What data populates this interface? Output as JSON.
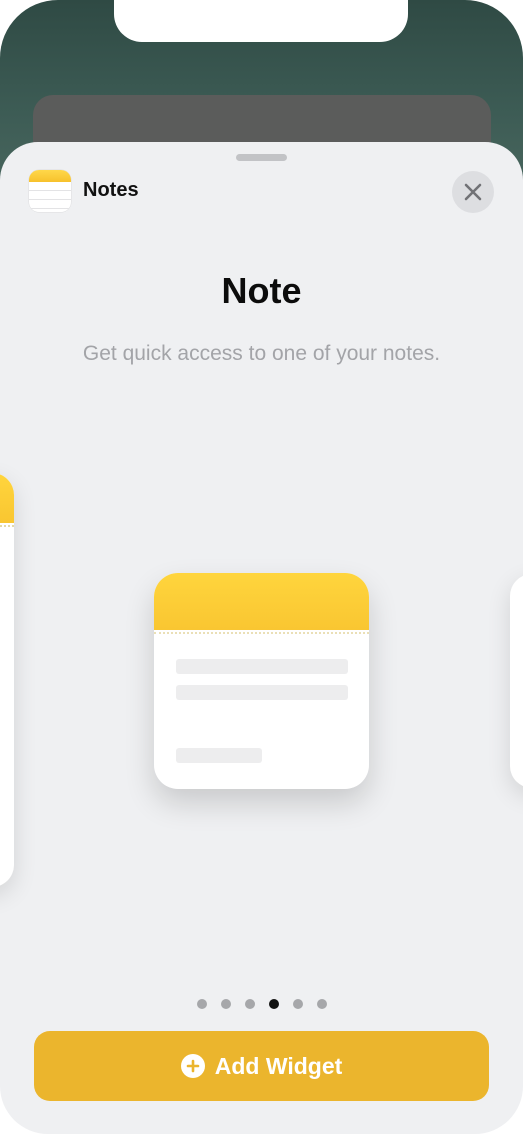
{
  "app": {
    "name": "Notes",
    "icon": "notes-app-icon"
  },
  "widget": {
    "title": "Note",
    "description": "Get quick access to one of your notes."
  },
  "pagination": {
    "count": 6,
    "active_index": 3
  },
  "actions": {
    "add_widget_label": "Add Widget",
    "add_icon": "plus-circle-icon",
    "close_icon": "close-icon"
  },
  "colors": {
    "accent": "#ebb52d",
    "notes_yellow": "#ffd53d",
    "sheet_bg": "#eff0f2"
  }
}
